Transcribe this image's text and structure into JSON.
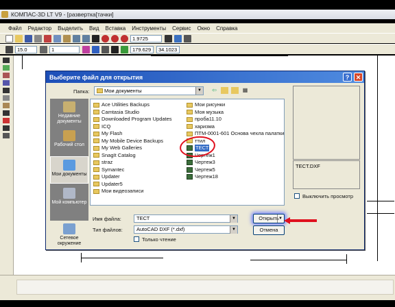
{
  "window": {
    "title": "КОМПАС-3D LT V9 - [развертка[тачки]"
  },
  "menu": [
    "Файл",
    "Редактор",
    "Выделить",
    "Вид",
    "Вставка",
    "Инструменты",
    "Сервис",
    "Окно",
    "Справка"
  ],
  "toolbar": {
    "zoom_value": "1.9725",
    "line_width": "15.0",
    "layer": "1",
    "coord_x": "179.629",
    "coord_y": "34.1023"
  },
  "dialog": {
    "title": "Выберите файл для открытия",
    "folder_label": "Папка:",
    "folder_value": "Мои документы",
    "places": [
      {
        "label": "Недавние документы"
      },
      {
        "label": "Рабочий стол"
      },
      {
        "label": "Мои документы"
      },
      {
        "label": "Мой компьютер"
      },
      {
        "label": "Сетевое окружение"
      }
    ],
    "files_col1": [
      "Ace Utilities Backups",
      "Camtasia Studio",
      "Downloaded Program Updates",
      "ICQ",
      "My Flash",
      "My Mobile Device Backups",
      "My Web Galleries",
      "SnagIt Catalog",
      "straz",
      "Symantec",
      "Updater",
      "Updater5",
      "Мои видеозаписи"
    ],
    "files_col2_folders": [
      "Мои рисунки",
      "Моя музыка",
      "проба11.10",
      "харизма",
      "ПТМ-0001-601 Основа чехла палатки",
      "ттил"
    ],
    "files_col2_docs": [
      "ТЕСТ",
      "Чертеж1",
      "Чертеж3",
      "Чертеж5",
      "Чертеж18"
    ],
    "preview_filename": "TECT.DXF",
    "disable_preview_label": "Выключить просмотр",
    "filename_label": "Имя файла:",
    "filename_value": "ТЕСТ",
    "filetype_label": "Тип файлов:",
    "filetype_value": "AutoCAD DXF (*.dxf)",
    "readonly_label": "Только чтение",
    "open_button": "Открыть",
    "cancel_button": "Отмена"
  },
  "colors": {
    "dialog_title": "#1d4fb8",
    "selection": "#316ac5",
    "annotation_red": "#e0101e"
  }
}
